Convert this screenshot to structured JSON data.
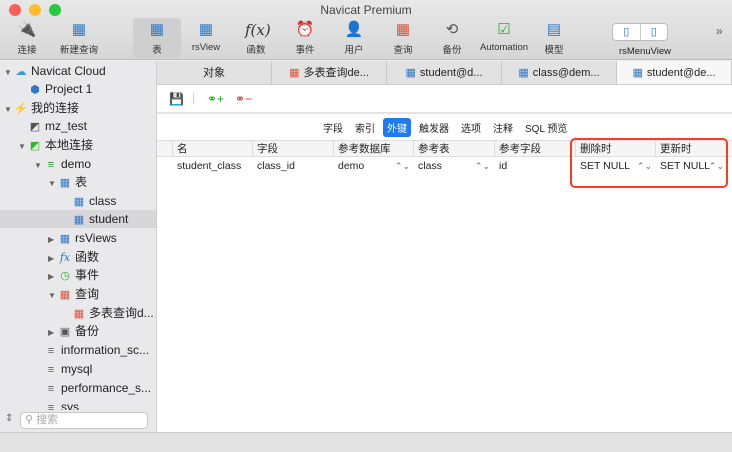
{
  "window": {
    "title": "Navicat Premium"
  },
  "toolbar": {
    "items": [
      {
        "label": "连接",
        "icon": "plug-icon"
      },
      {
        "label": "新建查询",
        "icon": "new-query-icon"
      },
      {
        "label": "表",
        "icon": "table-icon"
      },
      {
        "label": "rsView",
        "icon": "view-icon"
      },
      {
        "label": "函数",
        "icon": "function-icon"
      },
      {
        "label": "事件",
        "icon": "clock-icon"
      },
      {
        "label": "用户",
        "icon": "user-icon"
      },
      {
        "label": "查询",
        "icon": "query-icon"
      },
      {
        "label": "备份",
        "icon": "backup-icon"
      },
      {
        "label": "Automation",
        "icon": "automation-icon"
      },
      {
        "label": "模型",
        "icon": "model-icon"
      }
    ],
    "view_label": "rsMenuView",
    "more": "»"
  },
  "sidebar": {
    "items": [
      "Navicat Cloud",
      "Project 1",
      "我的连接",
      "mz_test",
      "本地连接",
      "demo",
      "表",
      "class",
      "student",
      "rsViews",
      "函数",
      "事件",
      "查询",
      "多表查询d...",
      "备份",
      "information_sc...",
      "mysql",
      "performance_s...",
      "sys"
    ],
    "search_placeholder": "搜索"
  },
  "tabs": [
    "对象",
    "多表查询de...",
    "student@d...",
    "class@dem...",
    "student@de..."
  ],
  "subtabs": [
    "字段",
    "索引",
    "外键",
    "触发器",
    "选项",
    "注释",
    "SQL 预览"
  ],
  "grid": {
    "headers": [
      "名",
      "字段",
      "参考数据库",
      "参考表",
      "参考字段",
      "删除时",
      "更新时"
    ],
    "rows": [
      [
        "student_class",
        "class_id",
        "demo",
        "class",
        "id",
        "SET NULL",
        "SET NULL"
      ]
    ]
  }
}
